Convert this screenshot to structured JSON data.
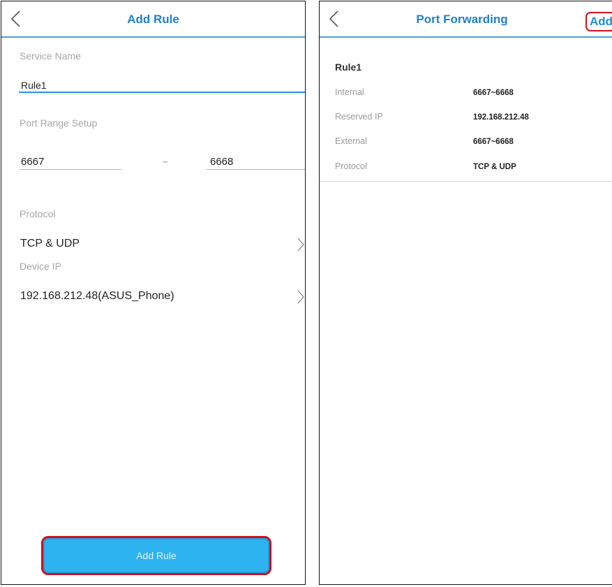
{
  "add_rule_screen": {
    "title": "Add Rule",
    "service_name_label": "Service Name",
    "service_name_value": "Rule1",
    "port_range_label": "Port Range Setup",
    "port_start": "6667",
    "port_separator": "~",
    "port_end": "6668",
    "protocol_label": "Protocol",
    "protocol_value": "TCP & UDP",
    "device_ip_label": "Device IP",
    "device_ip_value": "192.168.212.48(ASUS_Phone)",
    "submit_label": "Add Rule"
  },
  "port_forwarding_screen": {
    "title": "Port Forwarding",
    "add_label": "Add",
    "rule": {
      "name": "Rule1",
      "internal_label": "Internal",
      "internal_value": "6667~6668",
      "reserved_ip_label": "Reserved IP",
      "reserved_ip_value": "192.168.212.48",
      "external_label": "External",
      "external_value": "6667~6668",
      "protocol_label": "Protocol",
      "protocol_value": "TCP & UDP"
    }
  },
  "colors": {
    "accent": "#1d7fd0",
    "button": "#2db3f0",
    "highlight": "#d8101e"
  }
}
